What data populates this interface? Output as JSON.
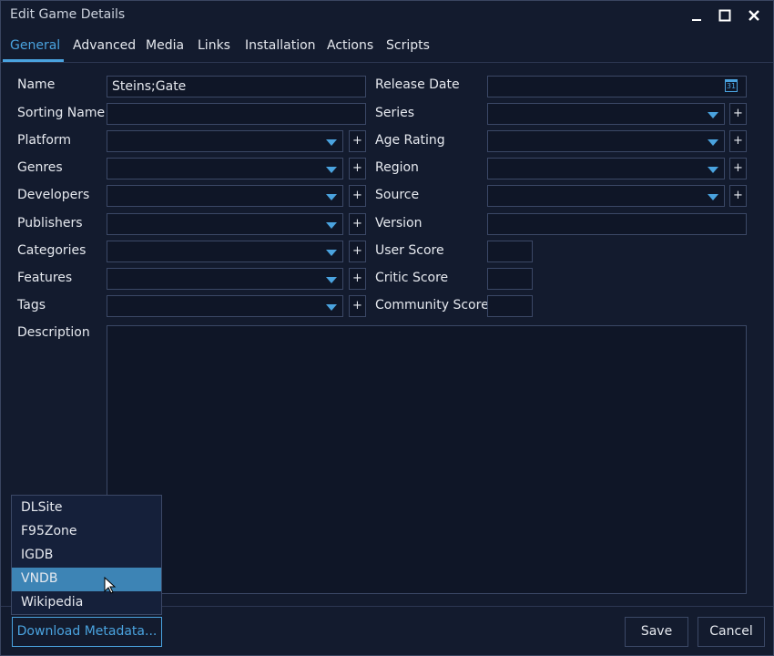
{
  "window": {
    "title": "Edit Game Details"
  },
  "tabs": [
    "General",
    "Advanced",
    "Media",
    "Links",
    "Installation",
    "Actions",
    "Scripts"
  ],
  "left_fields": {
    "name_label": "Name",
    "name_value": "Steins;Gate",
    "sorting_label": "Sorting Name",
    "platform_label": "Platform",
    "genres_label": "Genres",
    "developers_label": "Developers",
    "publishers_label": "Publishers",
    "categories_label": "Categories",
    "features_label": "Features",
    "tags_label": "Tags",
    "description_label": "Description"
  },
  "right_fields": {
    "release_label": "Release Date",
    "calendar_day": "31",
    "series_label": "Series",
    "age_label": "Age Rating",
    "region_label": "Region",
    "source_label": "Source",
    "version_label": "Version",
    "user_score_label": "User Score",
    "critic_score_label": "Critic Score",
    "community_score_label": "Community Score"
  },
  "plus_glyph": "+",
  "metadata_menu": [
    "DLSite",
    "F95Zone",
    "IGDB",
    "VNDB",
    "Wikipedia"
  ],
  "metadata_menu_highlighted": "VNDB",
  "footer": {
    "download": "Download Metadata...",
    "save": "Save",
    "cancel": "Cancel"
  },
  "colors": {
    "accent": "#4aa3df",
    "background": "#131b2e",
    "highlight": "#3d84b5"
  }
}
